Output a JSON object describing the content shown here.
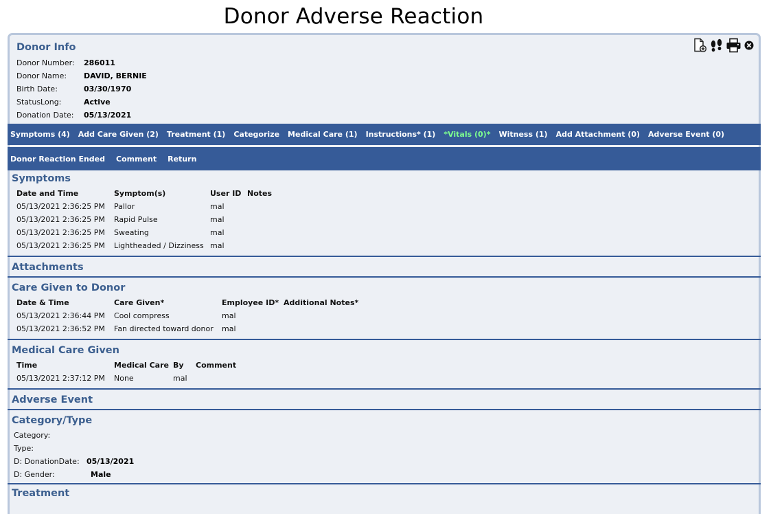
{
  "page_title": "Donor Adverse Reaction",
  "toolbar_icons": [
    "new-document-icon",
    "footprints-icon",
    "printer-icon",
    "close-circle-icon"
  ],
  "donor_info": {
    "title": "Donor Info",
    "fields": [
      {
        "label": "Donor Number:",
        "value": "286011"
      },
      {
        "label": "Donor Name:",
        "value": "DAVID, BERNIE"
      },
      {
        "label": "Birth Date:",
        "value": "03/30/1970"
      },
      {
        "label": "StatusLong:",
        "value": "Active"
      },
      {
        "label": "Donation Date:",
        "value": "05/13/2021"
      }
    ]
  },
  "nav_primary": [
    "Symptoms (4)",
    "Add Care Given (2)",
    "Treatment (1)",
    "Categorize",
    "Medical Care (1)",
    "Instructions* (1)",
    "*Vitals (0)*",
    "Witness (1)",
    "Add Attachment (0)",
    "Adverse Event (0)"
  ],
  "nav_secondary": [
    "Donor Reaction Ended",
    "Comment",
    "Return"
  ],
  "symptoms": {
    "title": "Symptoms",
    "headers": [
      "Date and Time",
      "Symptom(s)",
      "User ID",
      "Notes"
    ],
    "rows": [
      [
        "05/13/2021 2:36:25 PM",
        "Pallor",
        "mal",
        ""
      ],
      [
        "05/13/2021 2:36:25 PM",
        "Rapid Pulse",
        "mal",
        ""
      ],
      [
        "05/13/2021 2:36:25 PM",
        "Sweating",
        "mal",
        ""
      ],
      [
        "05/13/2021 2:36:25 PM",
        "Lightheaded / Dizziness",
        "mal",
        ""
      ]
    ]
  },
  "attachments": {
    "title": "Attachments"
  },
  "care_given": {
    "title": "Care Given to Donor",
    "headers": [
      "Date & Time",
      "Care Given*",
      "Employee ID*",
      "Additional Notes*"
    ],
    "rows": [
      [
        "05/13/2021 2:36:44 PM",
        "Cool compress",
        "mal",
        ""
      ],
      [
        "05/13/2021 2:36:52 PM",
        "Fan directed toward donor",
        "mal",
        ""
      ]
    ]
  },
  "medical_care": {
    "title": "Medical Care Given",
    "headers": [
      "Time",
      "Medical Care",
      "By",
      "Comment"
    ],
    "rows": [
      [
        "05/13/2021 2:37:12 PM",
        "None",
        "mal",
        ""
      ]
    ]
  },
  "adverse_event": {
    "title": "Adverse Event"
  },
  "category_type": {
    "title": "Category/Type",
    "fields": [
      {
        "label": "Category:",
        "value": ""
      },
      {
        "label": "Type:",
        "value": ""
      },
      {
        "label": "D: DonationDate:",
        "value": "05/13/2021"
      },
      {
        "label": "D: Gender:",
        "value": "Male"
      }
    ]
  },
  "treatment": {
    "title": "Treatment"
  }
}
